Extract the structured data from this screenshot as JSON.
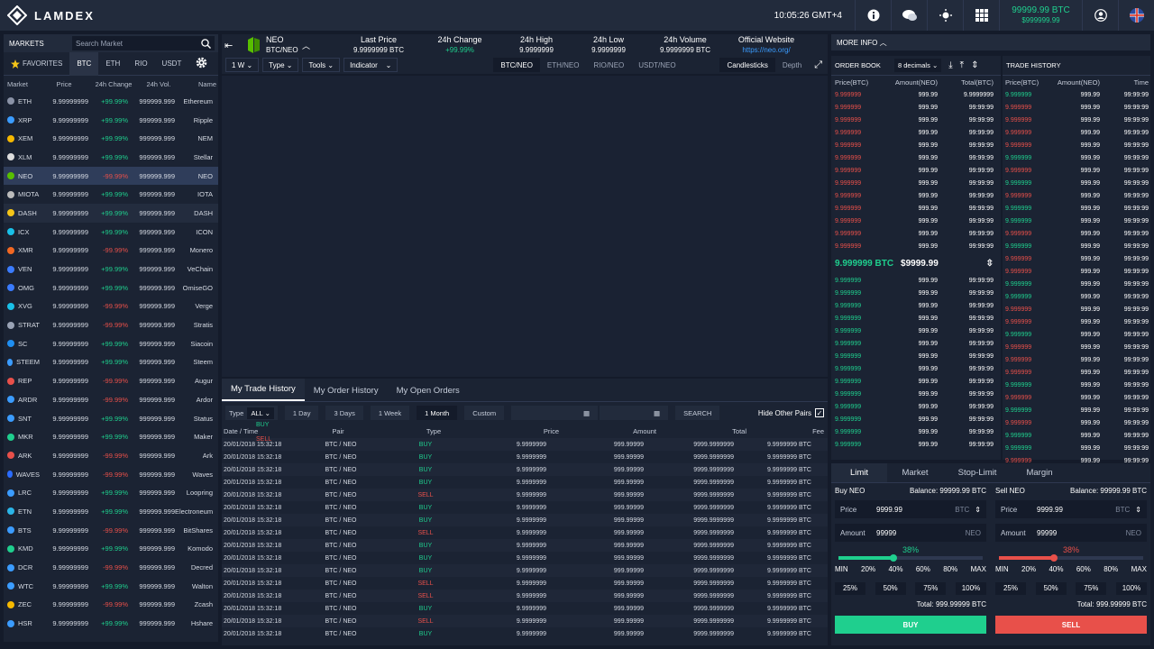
{
  "app": {
    "logo": "LAMDEX",
    "time": "10:05:26 GMT+4",
    "balance_btc": "99999.99 BTC",
    "balance_usd": "$999999.99"
  },
  "markets": {
    "title": "MARKETS",
    "search_placeholder": "Search Market",
    "tabs": [
      "FAVORITES",
      "BTC",
      "ETH",
      "RIO",
      "USDT"
    ],
    "columns": [
      "Market",
      "Price",
      "24h Change",
      "24h Vol.",
      "Name"
    ],
    "rows": [
      [
        "ETH",
        "9.99999999",
        "+99.99%",
        "999999.999",
        "Ethereum",
        "g"
      ],
      [
        "XRP",
        "9.99999999",
        "+99.99%",
        "999999.999",
        "Ripple",
        "g"
      ],
      [
        "XEM",
        "9.99999999",
        "+99.99%",
        "999999.999",
        "NEM",
        "g"
      ],
      [
        "XLM",
        "9.99999999",
        "+99.99%",
        "999999.999",
        "Stellar",
        "g"
      ],
      [
        "NEO",
        "9.99999999",
        "-99.99%",
        "999999.999",
        "NEO",
        "r"
      ],
      [
        "MIOTA",
        "9.99999999",
        "+99.99%",
        "999999.999",
        "IOTA",
        "g"
      ],
      [
        "DASH",
        "9.99999999",
        "+99.99%",
        "999999.999",
        "DASH",
        "g"
      ],
      [
        "ICX",
        "9.99999999",
        "+99.99%",
        "999999.999",
        "ICON",
        "g"
      ],
      [
        "XMR",
        "9.99999999",
        "-99.99%",
        "999999.999",
        "Monero",
        "r"
      ],
      [
        "VEN",
        "9.99999999",
        "+99.99%",
        "999999.999",
        "VeChain",
        "g"
      ],
      [
        "OMG",
        "9.99999999",
        "+99.99%",
        "999999.999",
        "OmiseGO",
        "g"
      ],
      [
        "XVG",
        "9.99999999",
        "-99.99%",
        "999999.999",
        "Verge",
        "r"
      ],
      [
        "STRAT",
        "9.99999999",
        "-99.99%",
        "999999.999",
        "Stratis",
        "r"
      ],
      [
        "SC",
        "9.99999999",
        "+99.99%",
        "999999.999",
        "Siacoin",
        "g"
      ],
      [
        "STEEM",
        "9.99999999",
        "+99.99%",
        "999999.999",
        "Steem",
        "g"
      ],
      [
        "REP",
        "9.99999999",
        "-99.99%",
        "999999.999",
        "Augur",
        "r"
      ],
      [
        "ARDR",
        "9.99999999",
        "-99.99%",
        "999999.999",
        "Ardor",
        "r"
      ],
      [
        "SNT",
        "9.99999999",
        "+99.99%",
        "999999.999",
        "Status",
        "g"
      ],
      [
        "MKR",
        "9.99999999",
        "+99.99%",
        "999999.999",
        "Maker",
        "g"
      ],
      [
        "ARK",
        "9.99999999",
        "-99.99%",
        "999999.999",
        "Ark",
        "r"
      ],
      [
        "WAVES",
        "9.99999999",
        "-99.99%",
        "999999.999",
        "Waves",
        "r"
      ],
      [
        "LRC",
        "9.99999999",
        "+99.99%",
        "999999.999",
        "Loopring",
        "g"
      ],
      [
        "ETN",
        "9.99999999",
        "+99.99%",
        "999999.999",
        "Electroneum",
        "g"
      ],
      [
        "BTS",
        "9.99999999",
        "-99.99%",
        "999999.999",
        "BitShares",
        "r"
      ],
      [
        "KMD",
        "9.99999999",
        "+99.99%",
        "999999.999",
        "Komodo",
        "g"
      ],
      [
        "DCR",
        "9.99999999",
        "-99.99%",
        "999999.999",
        "Decred",
        "r"
      ],
      [
        "WTC",
        "9.99999999",
        "+99.99%",
        "999999.999",
        "Walton",
        "g"
      ],
      [
        "ZEC",
        "9.99999999",
        "-99.99%",
        "999999.999",
        "Zcash",
        "r"
      ],
      [
        "HSR",
        "9.99999999",
        "+99.99%",
        "999999.999",
        "Hshare",
        "g"
      ]
    ]
  },
  "pair": {
    "name": "NEO",
    "pair": "BTC/NEO",
    "last_price_label": "Last Price",
    "last_price": "9.9999999 BTC",
    "change_label": "24h Change",
    "change": "+99.99%",
    "high_label": "24h High",
    "high": "9.9999999",
    "low_label": "24h Low",
    "low": "9.9999999",
    "vol_label": "24h Volume",
    "vol": "9.9999999 BTC",
    "site_label": "Official Website",
    "site": "https://neo.org/"
  },
  "toolbar": {
    "interval": "1 W",
    "type": "Type",
    "tools": "Tools",
    "indicator": "Indicator",
    "pairs": [
      "BTC/NEO",
      "ETH/NEO",
      "RIO/NEO",
      "USDT/NEO"
    ],
    "candle": "Candlesticks",
    "depth": "Depth"
  },
  "history": {
    "tabs": [
      "My Trade History",
      "My Order History",
      "My Open Orders"
    ],
    "type_label": "Type",
    "type_value": "ALL",
    "dropdown": [
      "BUY",
      "SELL"
    ],
    "ranges": [
      "1 Day",
      "3 Days",
      "1 Week",
      "1 Month",
      "Custom"
    ],
    "search": "SEARCH",
    "hide": "Hide Other Pairs",
    "columns": [
      "Date / Time",
      "Pair",
      "Type",
      "Price",
      "Amount",
      "Total",
      "Fee"
    ],
    "rows": [
      [
        "20/01/2018",
        "15:32:18",
        "BTC / NEO",
        "BUY",
        "9.9999999",
        "999.99999",
        "9999.9999999",
        "9.9999999 BTC"
      ],
      [
        "20/01/2018",
        "15:32:18",
        "BTC / NEO",
        "BUY",
        "9.9999999",
        "999.99999",
        "9999.9999999",
        "9.9999999 BTC"
      ],
      [
        "20/01/2018",
        "15:32:18",
        "BTC / NEO",
        "BUY",
        "9.9999999",
        "999.99999",
        "9999.9999999",
        "9.9999999 BTC"
      ],
      [
        "20/01/2018",
        "15:32:18",
        "BTC / NEO",
        "BUY",
        "9.9999999",
        "999.99999",
        "9999.9999999",
        "9.9999999 BTC"
      ],
      [
        "20/01/2018",
        "15:32:18",
        "BTC / NEO",
        "SELL",
        "9.9999999",
        "999.99999",
        "9999.9999999",
        "9.9999999 BTC"
      ],
      [
        "20/01/2018",
        "15:32:18",
        "BTC / NEO",
        "BUY",
        "9.9999999",
        "999.99999",
        "9999.9999999",
        "9.9999999 BTC"
      ],
      [
        "20/01/2018",
        "15:32:18",
        "BTC / NEO",
        "BUY",
        "9.9999999",
        "999.99999",
        "9999.9999999",
        "9.9999999 BTC"
      ],
      [
        "20/01/2018",
        "15:32:18",
        "BTC / NEO",
        "SELL",
        "9.9999999",
        "999.99999",
        "9999.9999999",
        "9.9999999 BTC"
      ],
      [
        "20/01/2018",
        "15:32:18",
        "BTC / NEO",
        "BUY",
        "9.9999999",
        "999.99999",
        "9999.9999999",
        "9.9999999 BTC"
      ],
      [
        "20/01/2018",
        "15:32:18",
        "BTC / NEO",
        "BUY",
        "9.9999999",
        "999.99999",
        "9999.9999999",
        "9.9999999 BTC"
      ],
      [
        "20/01/2018",
        "15:32:18",
        "BTC / NEO",
        "BUY",
        "9.9999999",
        "999.99999",
        "9999.9999999",
        "9.9999999 BTC"
      ],
      [
        "20/01/2018",
        "15:32:18",
        "BTC / NEO",
        "SELL",
        "9.9999999",
        "999.99999",
        "9999.9999999",
        "9.9999999 BTC"
      ],
      [
        "20/01/2018",
        "15:32:18",
        "BTC / NEO",
        "SELL",
        "9.9999999",
        "999.99999",
        "9999.9999999",
        "9.9999999 BTC"
      ],
      [
        "20/01/2018",
        "15:32:18",
        "BTC / NEO",
        "BUY",
        "9.9999999",
        "999.99999",
        "9999.9999999",
        "9.9999999 BTC"
      ],
      [
        "20/01/2018",
        "15:32:18",
        "BTC / NEO",
        "SELL",
        "9.9999999",
        "999.99999",
        "9999.9999999",
        "9.9999999 BTC"
      ],
      [
        "20/01/2018",
        "15:32:18",
        "BTC / NEO",
        "BUY",
        "9.9999999",
        "999.99999",
        "9999.9999999",
        "9.9999999 BTC"
      ]
    ]
  },
  "moreinfo": "MORE INFO",
  "orderbook": {
    "title": "ORDER BOOK",
    "decimals": "8 decimals",
    "columns": [
      "Price(BTC)",
      "Amount(NEO)",
      "Total(BTC)"
    ],
    "ask_price": "9.999999",
    "amount": "999.99",
    "ask_total_first": "9.9999999",
    "total": "99:99:99",
    "asks": 13,
    "bids": 14,
    "mid_btc": "9.999999 BTC",
    "mid_usd": "$9999.99"
  },
  "tradehistory": {
    "title": "TRADE HISTORY",
    "columns": [
      "Price(BTC)",
      "Amount(NEO)",
      "Time"
    ],
    "price": "9.999999",
    "amount": "999.99",
    "time": "99:99:99",
    "colors": [
      "g",
      "r",
      "r",
      "r",
      "r",
      "g",
      "r",
      "g",
      "r",
      "g",
      "g",
      "r",
      "g",
      "r",
      "r",
      "g",
      "g",
      "r",
      "r",
      "g",
      "r",
      "r",
      "r",
      "g",
      "r",
      "g",
      "r",
      "g",
      "g",
      "r"
    ]
  },
  "trade": {
    "tabs": [
      "Limit",
      "Market",
      "Stop-Limit",
      "Margin"
    ],
    "buy": {
      "title": "Buy NEO",
      "balance": "Balance: 99999.99 BTC",
      "price_label": "Price",
      "price": "9999.99",
      "price_unit": "BTC",
      "amount_label": "Amount",
      "amount": "99999",
      "amount_unit": "NEO",
      "pct": "38%",
      "pct_value": 0.38,
      "total": "Total: 999.99999 BTC",
      "button": "BUY"
    },
    "sell": {
      "title": "Sell NEO",
      "balance": "Balance: 99999.99 BTC",
      "price_label": "Price",
      "price": "9999.99",
      "price_unit": "BTC",
      "amount_label": "Amount",
      "amount": "99999",
      "amount_unit": "NEO",
      "pct": "38%",
      "pct_value": 0.38,
      "total": "Total: 999.99999 BTC",
      "button": "SELL"
    },
    "marks": [
      "MIN",
      "20%",
      "40%",
      "60%",
      "80%",
      "MAX"
    ],
    "quick": [
      "25%",
      "50%",
      "75%",
      "100%"
    ]
  },
  "colors": {
    "buy": "#1fcf8e",
    "sell": "#e8504a",
    "bg": "#141b2a"
  }
}
